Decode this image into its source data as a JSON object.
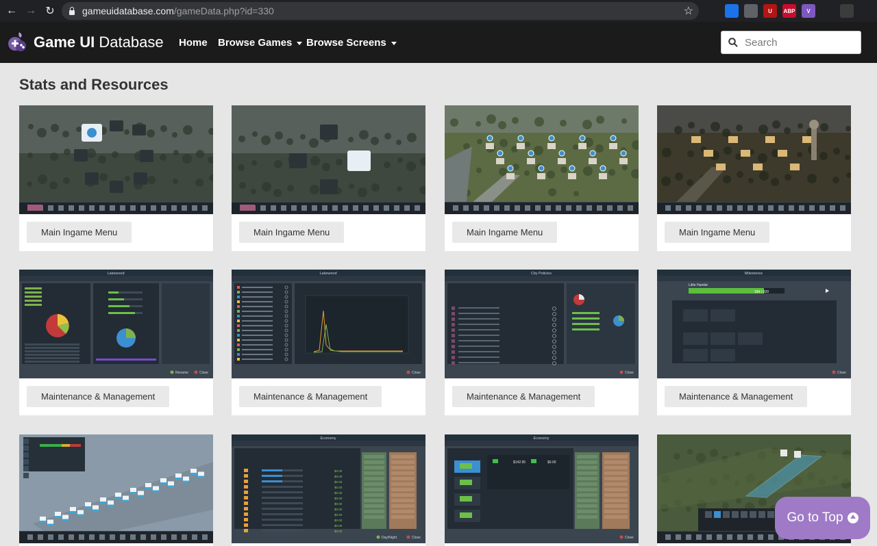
{
  "browser": {
    "url_host": "gameuidatabase.com",
    "url_path": "/gameData.php?id=330",
    "back_glyph": "←",
    "forward_glyph": "→",
    "reload_glyph": "↻",
    "star_glyph": "☆",
    "extensions": [
      {
        "icon": "bird-icon",
        "label": "",
        "color": "#202124"
      },
      {
        "icon": "window-icon",
        "label": "",
        "color": "#1a73e8"
      },
      {
        "icon": "image-icon",
        "label": "",
        "color": "#5f6368"
      },
      {
        "icon": "ublock-icon",
        "label": "U",
        "color": "#b31414"
      },
      {
        "icon": "adblock-icon",
        "label": "ABP",
        "color": "#c70d2c"
      },
      {
        "icon": "v-icon",
        "label": "V",
        "color": "#7e57c2"
      },
      {
        "icon": "puzzle-icon",
        "label": "",
        "color": "#202124"
      },
      {
        "icon": "avatar-icon",
        "label": "",
        "color": "#3c3c3c"
      }
    ]
  },
  "header": {
    "brand_bold": "Game UI",
    "brand_light": " Database",
    "nav": [
      {
        "label": "Home",
        "dropdown": false
      },
      {
        "label": "Browse Games",
        "dropdown": true
      },
      {
        "label": "Browse Screens",
        "dropdown": true
      }
    ],
    "search_placeholder": "Search"
  },
  "section_title": "Stats and Resources",
  "cards": [
    {
      "tag": "Main Ingame Menu",
      "theme": "menu-forest"
    },
    {
      "tag": "Main Ingame Menu",
      "theme": "menu-forest2"
    },
    {
      "tag": "Main Ingame Menu",
      "theme": "town-day"
    },
    {
      "tag": "Main Ingame Menu",
      "theme": "town-night"
    },
    {
      "tag": "Maintenance & Management",
      "theme": "panel-city"
    },
    {
      "tag": "Maintenance & Management",
      "theme": "panel-stats"
    },
    {
      "tag": "Maintenance & Management",
      "theme": "panel-policies"
    },
    {
      "tag": "Maintenance & Management",
      "theme": "panel-milestones"
    },
    {
      "tag": "",
      "theme": "grid-blue"
    },
    {
      "tag": "",
      "theme": "panel-economy"
    },
    {
      "tag": "",
      "theme": "panel-economy2"
    },
    {
      "tag": "",
      "theme": "zone-green"
    }
  ],
  "thumb_text": {
    "lakewood": "Lakewood",
    "city_policies": "City Policies",
    "milestones": "Milestones",
    "economy": "Economy",
    "little_hamlet": "Little Hamlet",
    "milestone_value": "184 / 320",
    "close": "Close",
    "rename": "Rename",
    "daynight": "Day/Night"
  },
  "go_top": {
    "label": "Go to Top"
  }
}
